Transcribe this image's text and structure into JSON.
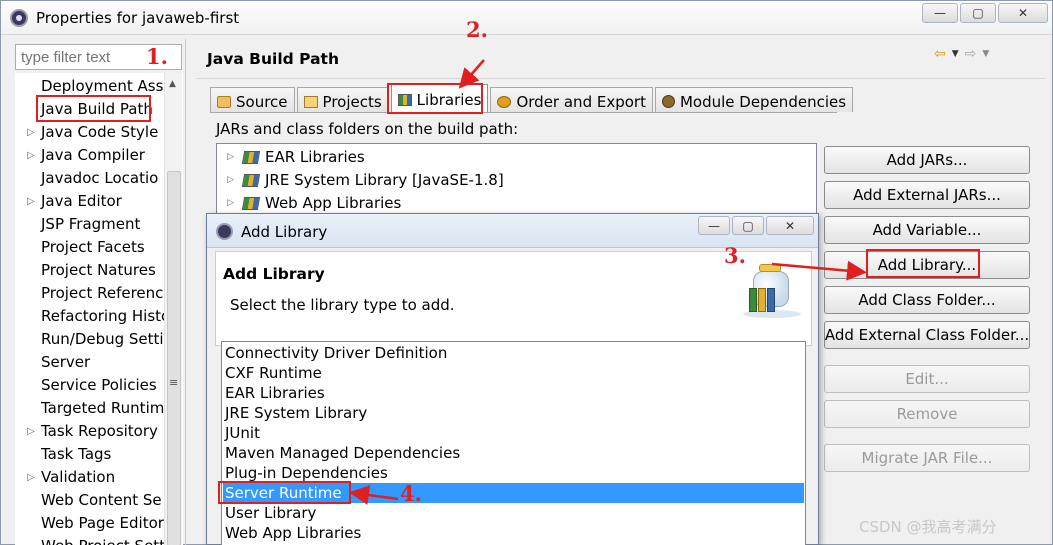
{
  "window": {
    "title": "Properties for javaweb-first",
    "minimize": "—",
    "maximize": "▢",
    "close": "✕"
  },
  "left_pane": {
    "filter_placeholder": "type filter text",
    "items": [
      "Deployment Ass",
      "Java Build Path",
      "Java Code Style",
      "Java Compiler",
      "Javadoc Locatio",
      "Java Editor",
      "JSP Fragment",
      "Project Facets",
      "Project Natures",
      "Project Referenc",
      "Refactoring Histo",
      "Run/Debug Setti",
      "Server",
      "Service Policies",
      "Targeted Runtim",
      "Task Repository",
      "Task Tags",
      "Validation",
      "Web Content Se",
      "Web Page Editor",
      "Web Project Sett"
    ],
    "expandable": [
      2,
      3,
      5,
      15,
      17
    ]
  },
  "right_pane": {
    "title": "Java Build Path",
    "tabs": [
      "Source",
      "Projects",
      "Libraries",
      "Order and Export",
      "Module Dependencies"
    ],
    "active_tab": "Libraries",
    "jar_label": "JARs and class folders on the build path:",
    "libraries": [
      "EAR Libraries",
      "JRE System Library [JavaSE-1.8]",
      "Web App Libraries"
    ],
    "buttons": {
      "add_jars": "Add JARs...",
      "add_external_jars": "Add External JARs...",
      "add_variable": "Add Variable...",
      "add_library": "Add Library...",
      "add_class_folder": "Add Class Folder...",
      "add_external_class_folder": "Add External Class Folder...",
      "edit": "Edit...",
      "remove": "Remove",
      "migrate_jar": "Migrate JAR File..."
    }
  },
  "dialog": {
    "title": "Add Library",
    "heading": "Add Library",
    "description": "Select the library type to add.",
    "library_types": [
      "Connectivity Driver Definition",
      "CXF Runtime",
      "EAR Libraries",
      "JRE System Library",
      "JUnit",
      "Maven Managed Dependencies",
      "Plug-in Dependencies",
      "Server Runtime",
      "User Library",
      "Web App Libraries"
    ],
    "selected": "Server Runtime"
  },
  "annotations": {
    "step1": "1.",
    "step2": "2.",
    "step3": "3.",
    "step4": "4.",
    "color": "#e02020"
  },
  "watermark": "CSDN @我高考满分"
}
